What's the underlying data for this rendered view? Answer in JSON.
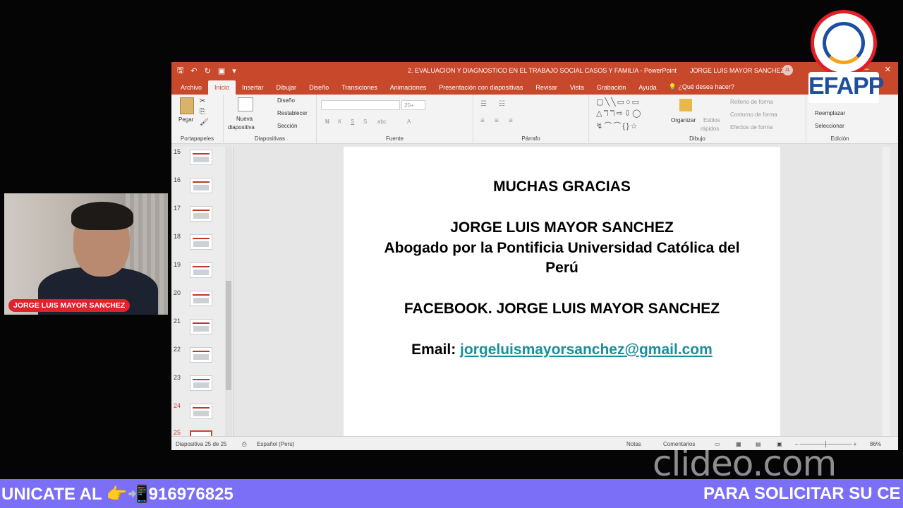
{
  "window": {
    "document_title": "2. EVALUACION Y DIAGNOSTICO EN EL TRABAJO SOCIAL CASOS Y FAMILIA  -  PowerPoint",
    "user_name": "JORGE LUIS MAYOR SANCHEZ",
    "user_initials": "JL"
  },
  "tabs": [
    {
      "label": "Archivo"
    },
    {
      "label": "Inicio"
    },
    {
      "label": "Insertar"
    },
    {
      "label": "Dibujar"
    },
    {
      "label": "Diseño"
    },
    {
      "label": "Transiciones"
    },
    {
      "label": "Animaciones"
    },
    {
      "label": "Presentación con diapositivas"
    },
    {
      "label": "Revisar"
    },
    {
      "label": "Vista"
    },
    {
      "label": "Grabación"
    },
    {
      "label": "Ayuda"
    }
  ],
  "tell_me": "¿Qué desea hacer?",
  "ribbon": {
    "pegar": "Pegar",
    "portapapeles": "Portapapeles",
    "nueva_diapositiva": "Nueva",
    "nueva_diapositiva2": "diapositiva",
    "diseno": "Diseño",
    "restablecer": "Restablecer",
    "seccion": "Sección",
    "diapositivas": "Diapositivas",
    "font_size": "20+",
    "fuente": "Fuente",
    "parrafo": "Párrafo",
    "organizar": "Organizar",
    "estilos": "Estilos",
    "rapidos": "rápidos",
    "relleno": "Relleno de forma",
    "contorno": "Contorno de forma",
    "efectos": "Efectos de forma",
    "dibujo": "Dibujo",
    "reemplazar": "Reemplazar",
    "seleccionar": "Seleccionar",
    "edicion": "Edición"
  },
  "thumbnails": [
    {
      "num": "15"
    },
    {
      "num": "16"
    },
    {
      "num": "17"
    },
    {
      "num": "18"
    },
    {
      "num": "19"
    },
    {
      "num": "20"
    },
    {
      "num": "21"
    },
    {
      "num": "22"
    },
    {
      "num": "23"
    },
    {
      "num": "24"
    },
    {
      "num": "25"
    }
  ],
  "slide": {
    "line1": "MUCHAS GRACIAS",
    "line2": "JORGE LUIS MAYOR SANCHEZ",
    "line3": "Abogado por la Pontificia Universidad Católica del",
    "line4": "Perú",
    "line5": "FACEBOOK. JORGE LUIS MAYOR SANCHEZ",
    "email_label": "Email:",
    "email": "jorgeluismayorsanchez@gmail.com"
  },
  "status": {
    "slide_count": "Diapositiva 25 de 25",
    "language": "Español (Perú)",
    "notas": "Notas",
    "comentarios": "Comentarios",
    "zoom": "86%"
  },
  "cam": {
    "name": "JORGE LUIS MAYOR SANCHEZ"
  },
  "logo": {
    "text": "EFAPP"
  },
  "watermark": "clideo.com",
  "ticker": {
    "left": "UNICATE AL 👉📲916976825",
    "right": "PARA SOLICITAR SU CE"
  },
  "colors": {
    "accent": "#c8482c",
    "ticker": "#7b6ff7",
    "link": "#1a8f9c"
  }
}
